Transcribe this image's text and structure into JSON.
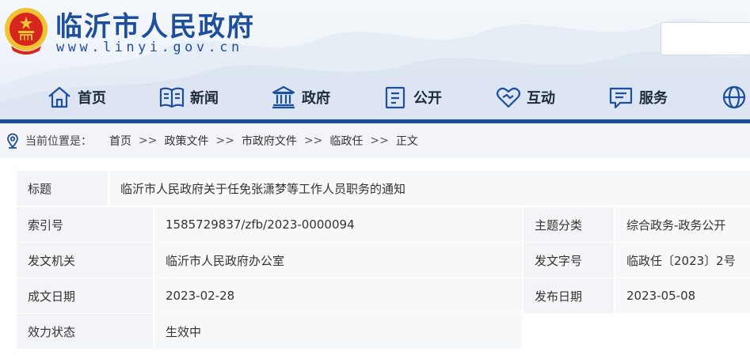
{
  "site": {
    "title": "临沂市人民政府",
    "url": "www.linyi.gov.cn"
  },
  "search": {
    "placeholder": ""
  },
  "nav": [
    {
      "label": "首页",
      "icon": "home-icon"
    },
    {
      "label": "新闻",
      "icon": "news-icon"
    },
    {
      "label": "政府",
      "icon": "government-building-icon"
    },
    {
      "label": "公开",
      "icon": "disclosure-document-icon"
    },
    {
      "label": "互动",
      "icon": "interaction-heart-icon"
    },
    {
      "label": "服务",
      "icon": "service-chat-icon"
    },
    {
      "label": "",
      "icon": "globe-icon"
    }
  ],
  "breadcrumb": {
    "prefix": "当前位置是：",
    "separator": ">>",
    "items": [
      "首页",
      "政策文件",
      "市政府文件",
      "临政任",
      "正文"
    ]
  },
  "document": {
    "title_key": "标题",
    "title_value": "临沂市人民政府关于任免张潇梦等工作人员职务的通知",
    "index_key": "索引号",
    "index_value": "1585729837/zfb/2023-0000094",
    "topic_key": "主题分类",
    "topic_value": "综合政务-政务公开",
    "issuer_key": "发文机关",
    "issuer_value": "临沂市人民政府办公室",
    "docno_key": "发文字号",
    "docno_value": "临政任〔2023〕2号",
    "date_key": "成文日期",
    "date_value": "2023-02-28",
    "pubdate_key": "发布日期",
    "pubdate_value": "2023-05-08",
    "status_key": "效力状态",
    "status_value": "生效中"
  },
  "colors": {
    "brand_blue": "#1d4f9c",
    "emblem_red": "#d7261e",
    "emblem_gold": "#f2c233"
  }
}
